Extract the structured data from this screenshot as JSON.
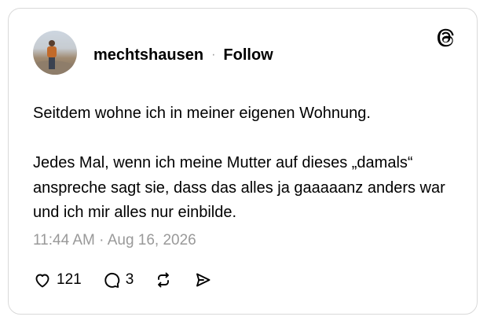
{
  "post": {
    "author": {
      "username": "mechtshausen",
      "separator": "·",
      "follow_label": "Follow"
    },
    "text": "Seitdem wohne ich in meiner eigenen Wohnung.\n\nJedes Mal, wenn ich meine Mutter auf dieses „damals“ anspreche sagt sie, dass das alles ja gaaaaanz anders war und ich mir alles nur einbilde.",
    "timestamp": "11:44 AM · Aug 16, 2026",
    "stats": {
      "likes": "121",
      "replies": "3"
    }
  },
  "icons": {
    "brand": "threads-logo-icon",
    "like": "heart-icon",
    "reply": "speech-bubble-icon",
    "repost": "repost-icon",
    "share": "send-icon"
  },
  "colors": {
    "text": "#000000",
    "muted": "#999999",
    "border": "#d9d9d9"
  }
}
